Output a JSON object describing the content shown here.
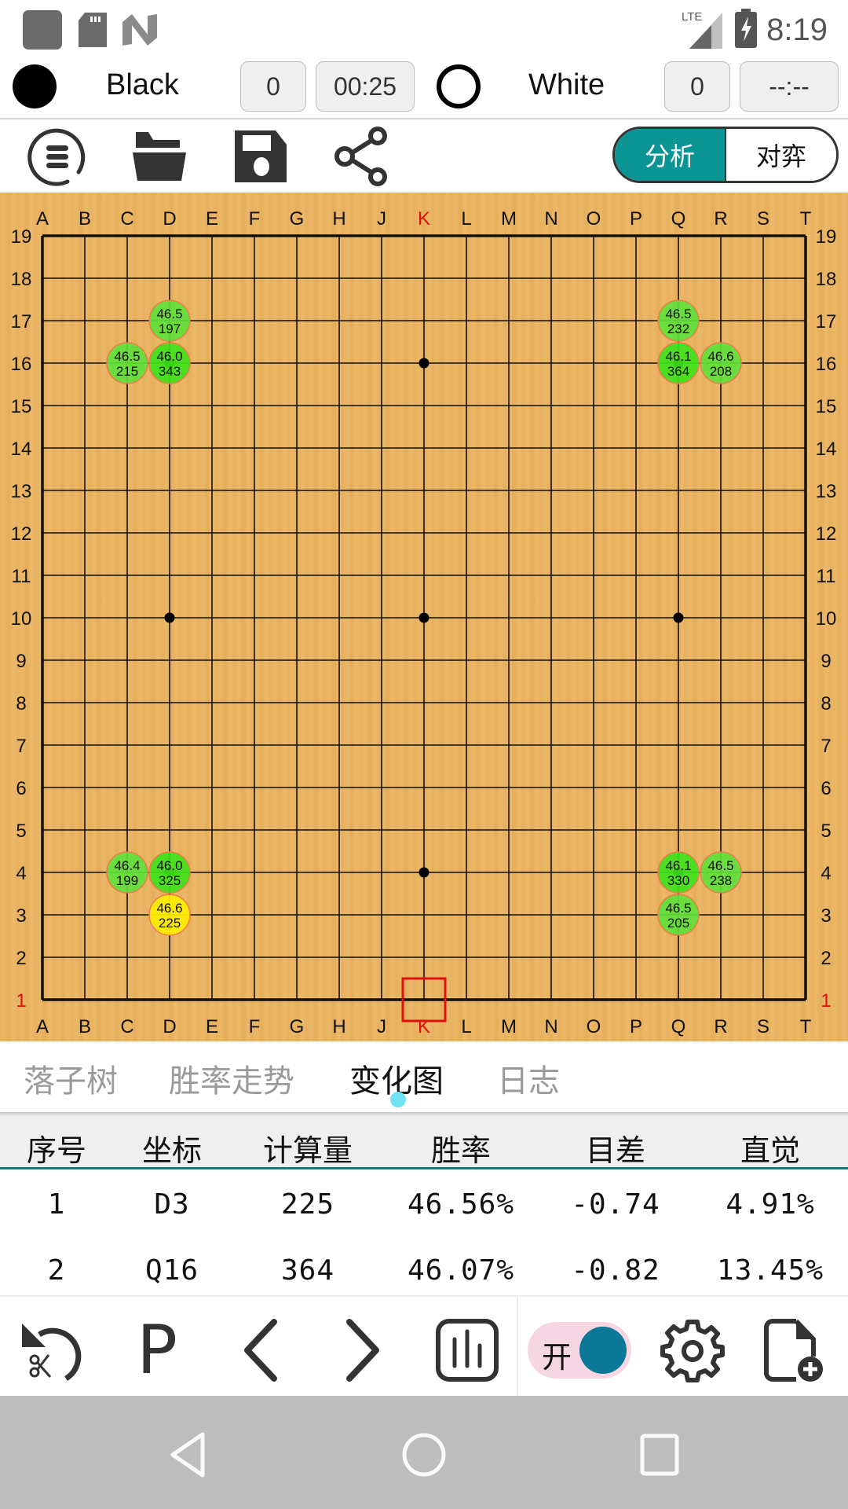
{
  "status_bar": {
    "time": "8:19",
    "network": "LTE",
    "left_icons": [
      "app-square-icon",
      "sd-card-icon",
      "n-logo-icon"
    ],
    "right_icons": [
      "lte-signal-icon",
      "battery-charging-icon"
    ]
  },
  "players": {
    "black": {
      "name": "Black",
      "captures": "0",
      "time": "00:25"
    },
    "white": {
      "name": "White",
      "captures": "0",
      "time": "--:--"
    }
  },
  "toolbar": {
    "icons": [
      "menu-icon",
      "folder-open-icon",
      "save-icon",
      "share-icon"
    ],
    "mode_options": [
      {
        "label": "分析",
        "active": true
      },
      {
        "label": "对弈",
        "active": false
      }
    ]
  },
  "board": {
    "size": 19,
    "columns": [
      "A",
      "B",
      "C",
      "D",
      "E",
      "F",
      "G",
      "H",
      "J",
      "K",
      "L",
      "M",
      "N",
      "O",
      "P",
      "Q",
      "R",
      "S",
      "T"
    ],
    "rows": [
      "19",
      "18",
      "17",
      "16",
      "15",
      "14",
      "13",
      "12",
      "11",
      "10",
      "9",
      "8",
      "7",
      "6",
      "5",
      "4",
      "3",
      "2",
      "1"
    ],
    "highlight_column": "K",
    "highlight_row": "1",
    "highlight_color": "#e01010",
    "last_move_marker": "K1",
    "star_points": [
      "D16",
      "K16",
      "Q16",
      "D10",
      "K10",
      "Q10",
      "D4",
      "K4",
      "Q4"
    ],
    "candidates": [
      {
        "coord": "D17",
        "winrate": "46.5",
        "visits": "197",
        "color": "#5ee03a"
      },
      {
        "coord": "C16",
        "winrate": "46.5",
        "visits": "215",
        "color": "#5ee03a"
      },
      {
        "coord": "D16",
        "winrate": "46.0",
        "visits": "343",
        "color": "#3ee21a"
      },
      {
        "coord": "Q17",
        "winrate": "46.5",
        "visits": "232",
        "color": "#5ee03a"
      },
      {
        "coord": "Q16",
        "winrate": "46.1",
        "visits": "364",
        "color": "#3ee21a"
      },
      {
        "coord": "R16",
        "winrate": "46.6",
        "visits": "208",
        "color": "#5ee03a"
      },
      {
        "coord": "C4",
        "winrate": "46.4",
        "visits": "199",
        "color": "#5ee03a"
      },
      {
        "coord": "D4",
        "winrate": "46.0",
        "visits": "325",
        "color": "#3ee21a"
      },
      {
        "coord": "D3",
        "winrate": "46.6",
        "visits": "225",
        "color": "#ffee00"
      },
      {
        "coord": "Q4",
        "winrate": "46.1",
        "visits": "330",
        "color": "#3ee21a"
      },
      {
        "coord": "R4",
        "winrate": "46.5",
        "visits": "238",
        "color": "#5ee03a"
      },
      {
        "coord": "Q3",
        "winrate": "46.5",
        "visits": "205",
        "color": "#5ee03a"
      }
    ]
  },
  "tabs": [
    {
      "label": "落子树",
      "active": false
    },
    {
      "label": "胜率走势",
      "active": false
    },
    {
      "label": "变化图",
      "active": true
    },
    {
      "label": "日志",
      "active": false
    }
  ],
  "table": {
    "headers": [
      "序号",
      "坐标",
      "计算量",
      "胜率",
      "目差",
      "直觉"
    ],
    "rows": [
      [
        "1",
        "D3",
        "225",
        "46.56%",
        "-0.74",
        "4.91%"
      ],
      [
        "2",
        "Q16",
        "364",
        "46.07%",
        "-0.82",
        "13.45%"
      ]
    ]
  },
  "bottom_bar": {
    "icons": [
      "undo-cut-icon",
      "pass-icon",
      "previous-icon",
      "next-icon",
      "chart-icon"
    ],
    "pass_label": "P",
    "engine_toggle": {
      "label": "开",
      "on": true
    },
    "right_icons": [
      "settings-icon",
      "new-file-icon"
    ]
  },
  "nav_bar": {
    "buttons": [
      "back-icon",
      "home-icon",
      "recents-icon"
    ]
  }
}
